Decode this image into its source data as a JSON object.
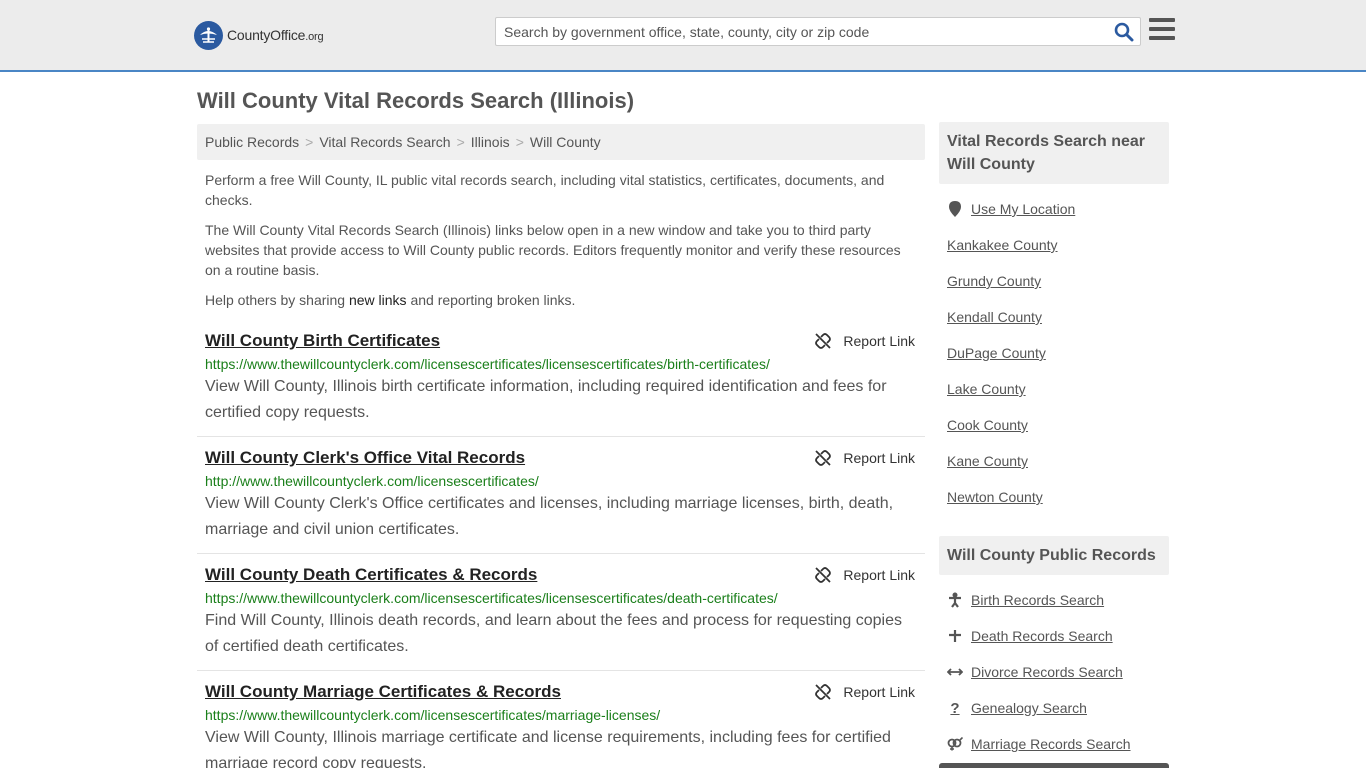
{
  "header": {
    "logo_main": "CountyOffice",
    "logo_suffix": ".org",
    "search_placeholder": "Search by government office, state, county, city or zip code"
  },
  "page_title": "Will County Vital Records Search (Illinois)",
  "breadcrumb": [
    "Public Records",
    "Vital Records Search",
    "Illinois",
    "Will County"
  ],
  "intro": {
    "p1": "Perform a free Will County, IL public vital records search, including vital statistics, certificates, documents, and checks.",
    "p2": "The Will County Vital Records Search (Illinois) links below open in a new window and take you to third party websites that provide access to Will County public records. Editors frequently monitor and verify these resources on a routine basis.",
    "p3_before": "Help others by sharing ",
    "p3_link": "new links",
    "p3_after": " and reporting broken links."
  },
  "report_label": "Report Link",
  "results": [
    {
      "title": "Will County Birth Certificates",
      "url": "https://www.thewillcountyclerk.com/licensescertificates/licensescertificates/birth-certificates/",
      "desc": "View Will County, Illinois birth certificate information, including required identification and fees for certified copy requests."
    },
    {
      "title": "Will County Clerk's Office Vital Records",
      "url": "http://www.thewillcountyclerk.com/licensescertificates/",
      "desc": "View Will County Clerk's Office certificates and licenses, including marriage licenses, birth, death, marriage and civil union certificates."
    },
    {
      "title": "Will County Death Certificates & Records",
      "url": "https://www.thewillcountyclerk.com/licensescertificates/licensescertificates/death-certificates/",
      "desc": "Find Will County, Illinois death records, and learn about the fees and process for requesting copies of certified death certificates."
    },
    {
      "title": "Will County Marriage Certificates & Records",
      "url": "https://www.thewillcountyclerk.com/licensescertificates/marriage-licenses/",
      "desc": "View Will County, Illinois marriage certificate and license requirements, including fees for certified marriage record copy requests."
    }
  ],
  "sidebar": {
    "nearby_title": "Vital Records Search near Will County",
    "use_location": "Use My Location",
    "nearby": [
      "Kankakee County",
      "Grundy County",
      "Kendall County",
      "DuPage County",
      "Lake County",
      "Cook County",
      "Kane County",
      "Newton County"
    ],
    "public_title": "Will County Public Records",
    "public_links": [
      {
        "label": "Birth Records Search",
        "icon": "baby-icon"
      },
      {
        "label": "Death Records Search",
        "icon": "cross-icon"
      },
      {
        "label": "Divorce Records Search",
        "icon": "split-arrows-icon"
      },
      {
        "label": "Genealogy Search",
        "icon": "question-icon"
      },
      {
        "label": "Marriage Records Search",
        "icon": "gender-rings-icon"
      }
    ]
  }
}
